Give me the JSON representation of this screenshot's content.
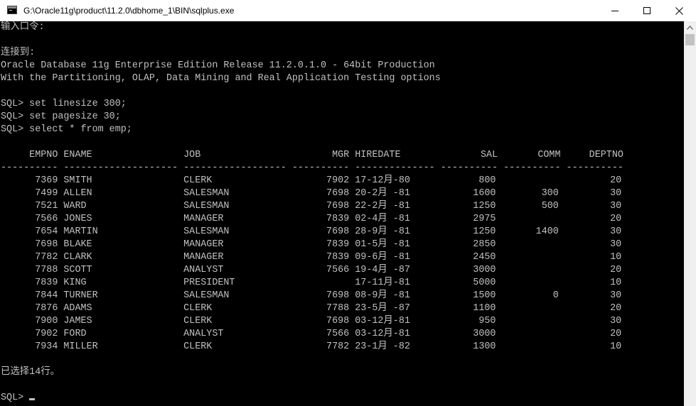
{
  "window": {
    "title": "G:\\Oracle11g\\product\\11.2.0\\dbhome_1\\BIN\\sqlplus.exe"
  },
  "icons": {
    "app": "console-window-icon",
    "minimize": "minimize-icon",
    "maximize": "maximize-icon",
    "close": "close-icon",
    "scroll_up": "chevron-up-icon"
  },
  "colors": {
    "terminal_bg": "#000000",
    "terminal_fg": "#c0c0c0",
    "titlebar_bg": "#ffffff"
  },
  "console": {
    "text": "输入口令:\n\n连接到:\nOracle Database 11g Enterprise Edition Release 11.2.0.1.0 - 64bit Production\nWith the Partitioning, OLAP, Data Mining and Real Application Testing options\n\nSQL> set linesize 300;\nSQL> set pagesize 30;\nSQL> select * from emp;\n\n     EMPNO ENAME                JOB                       MGR HIREDATE              SAL       COMM     DEPTNO\n---------- -------------------- ------------------ ---------- -------------- ---------- ---------- ----------\n      7369 SMITH                CLERK                    7902 17-12月-80            800                    20\n      7499 ALLEN                SALESMAN                 7698 20-2月 -81           1600        300         30\n      7521 WARD                 SALESMAN                 7698 22-2月 -81           1250        500         30\n      7566 JONES                MANAGER                  7839 02-4月 -81           2975                    20\n      7654 MARTIN               SALESMAN                 7698 28-9月 -81           1250       1400         30\n      7698 BLAKE                MANAGER                  7839 01-5月 -81           2850                    30\n      7782 CLARK                MANAGER                  7839 09-6月 -81           2450                    10\n      7788 SCOTT                ANALYST                  7566 19-4月 -87           3000                    20\n      7839 KING                 PRESIDENT                     17-11月-81           5000                    10\n      7844 TURNER               SALESMAN                 7698 08-9月 -81           1500          0         30\n      7876 ADAMS                CLERK                    7788 23-5月 -87           1100                    20\n      7900 JAMES                CLERK                    7698 03-12月-81            950                    30\n      7902 FORD                 ANALYST                  7566 03-12月-81           3000                    20\n      7934 MILLER               CLERK                    7782 23-1月 -82           1300                    10\n\n已选择14行。\n\nSQL> "
  }
}
